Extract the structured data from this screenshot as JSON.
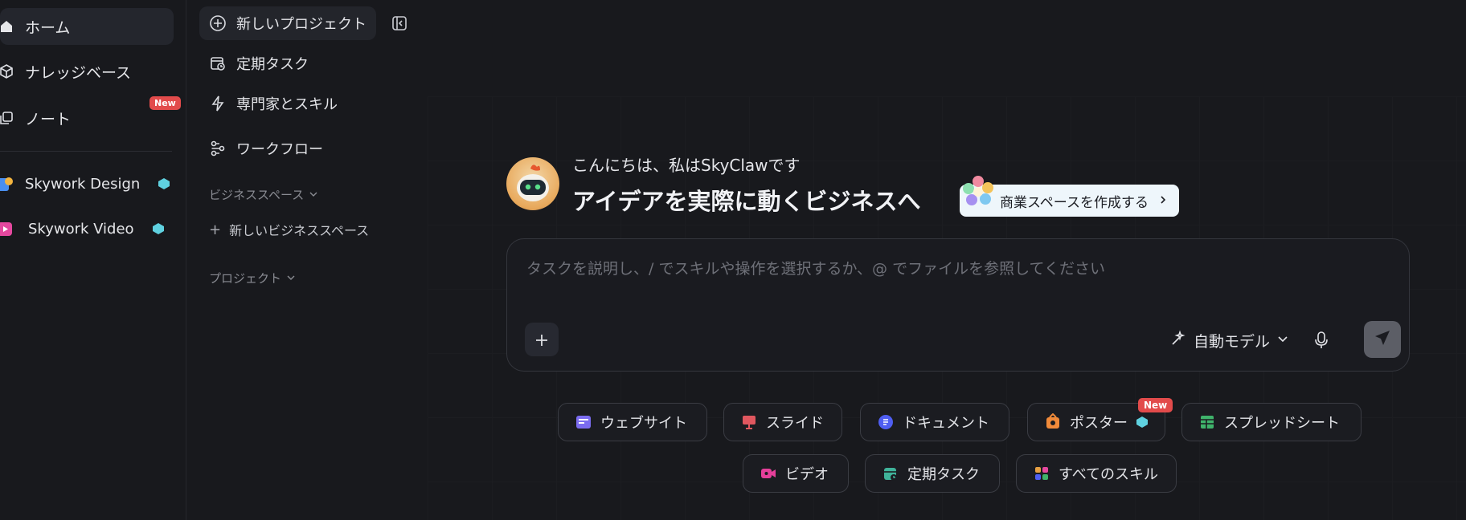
{
  "left_nav": {
    "items": [
      {
        "label": "ホーム",
        "icon": "home-icon"
      },
      {
        "label": "ナレッジベース",
        "icon": "cube-icon"
      },
      {
        "label": "ノート",
        "icon": "note-icon",
        "badge": "New"
      }
    ],
    "apps": [
      {
        "label": "Skywork Design",
        "icon": "design-app-icon"
      },
      {
        "label": "Skywork Video",
        "icon": "video-app-icon"
      }
    ]
  },
  "mid_nav": {
    "new_project": "新しいプロジェクト",
    "items": [
      {
        "label": "定期タスク",
        "icon": "calendar-clock-icon"
      },
      {
        "label": "専門家とスキル",
        "icon": "lightning-icon"
      },
      {
        "label": "ワークフロー",
        "icon": "workflow-icon"
      }
    ],
    "business_space_header": "ビジネススペース",
    "new_business_space": "新しいビジネススペース",
    "projects_header": "プロジェクト"
  },
  "main": {
    "greeting": "こんにちは、私はSkyClawです",
    "headline": "アイデアを実際に動くビジネスへ",
    "create_business_space": "商業スペースを作成する",
    "composer_placeholder": "タスクを説明し、/ でスキルや操作を選択するか、@ でファイルを参照してください",
    "model_label": "自動モデル",
    "chips_row1": [
      {
        "label": "ウェブサイト",
        "icon": "website-icon",
        "color": "#7b6cf0"
      },
      {
        "label": "スライド",
        "icon": "slides-icon",
        "color": "#e0575f"
      },
      {
        "label": "ドキュメント",
        "icon": "document-icon",
        "color": "#4f5ef2"
      },
      {
        "label": "ポスター",
        "icon": "poster-icon",
        "color": "#f08a3a",
        "badge": "New"
      },
      {
        "label": "スプレッドシート",
        "icon": "spreadsheet-icon",
        "color": "#3fb36b"
      }
    ],
    "chips_row2": [
      {
        "label": "ビデオ",
        "icon": "video-icon",
        "color": "#e53f9a"
      },
      {
        "label": "定期タスク",
        "icon": "calendar-clock-icon",
        "color": "#3fb39a"
      },
      {
        "label": "すべてのスキル",
        "icon": "all-skills-icon",
        "color": "#e7a043"
      }
    ]
  }
}
